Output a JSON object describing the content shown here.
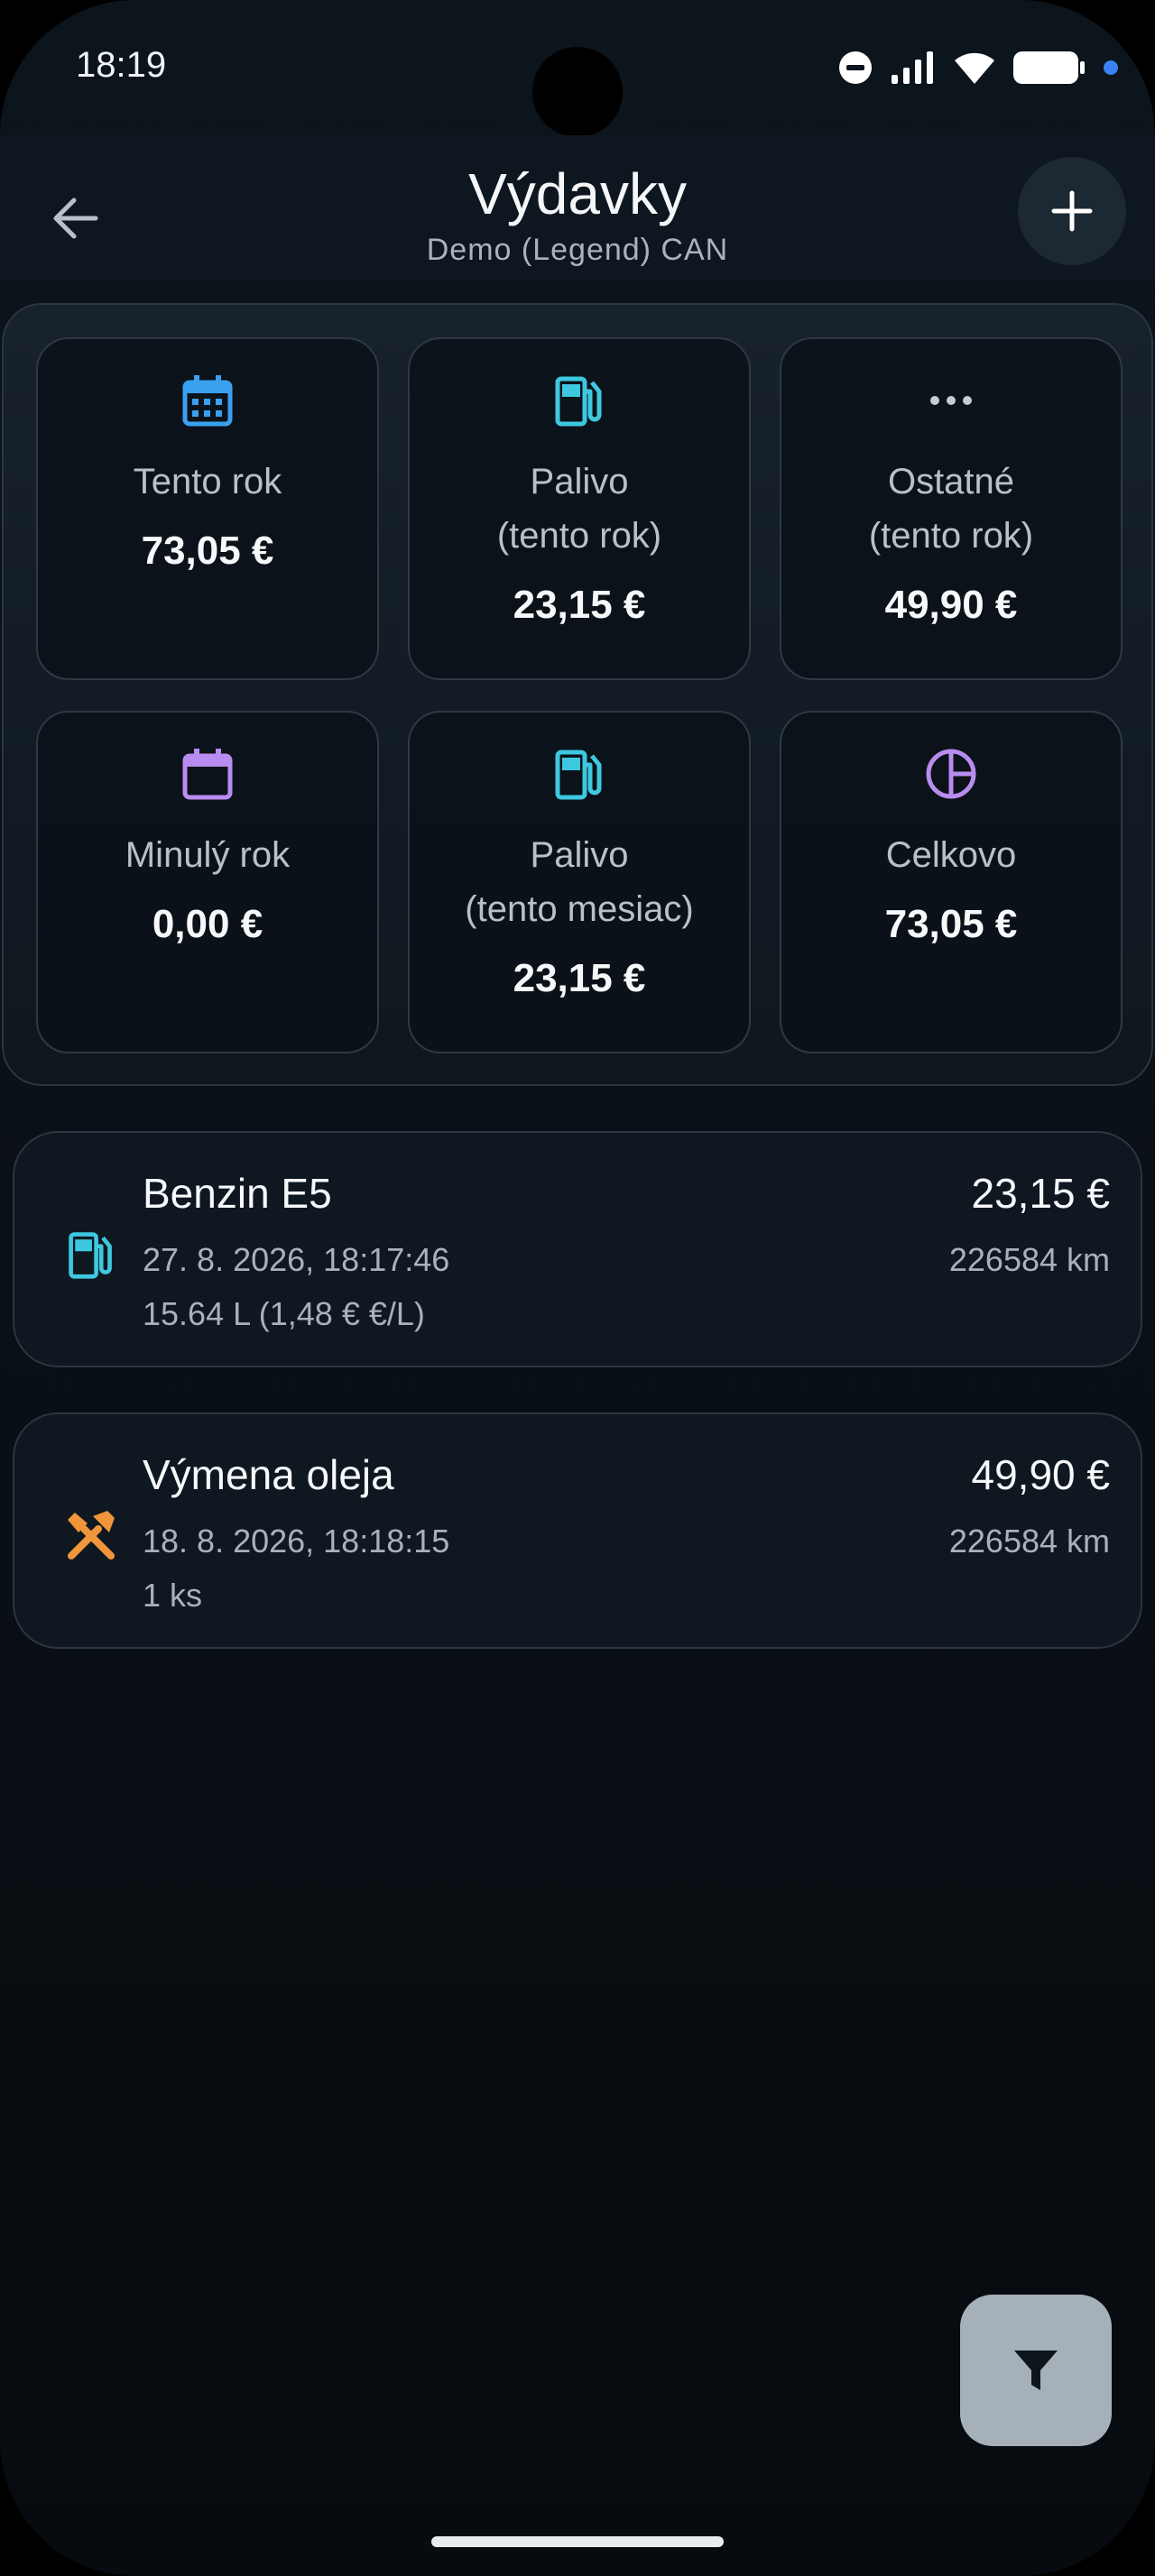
{
  "status_bar": {
    "time": "18:19"
  },
  "header": {
    "title": "Výdavky",
    "subtitle": "Demo (Legend) CAN"
  },
  "summary": {
    "cards": [
      {
        "icon": "calendar-icon",
        "label_line1": "Tento rok",
        "label_line2": "",
        "value": "73,05 €",
        "icon_color": "#3aa0f0"
      },
      {
        "icon": "fuel-pump-icon",
        "label_line1": "Palivo",
        "label_line2": "(tento rok)",
        "value": "23,15 €",
        "icon_color": "#3ec8e0"
      },
      {
        "icon": "more-icon",
        "label_line1": "Ostatné",
        "label_line2": "(tento rok)",
        "value": "49,90 €",
        "icon_color": "#c4ccd4"
      },
      {
        "icon": "calendar-icon",
        "label_line1": "Minulý rok",
        "label_line2": "",
        "value": "0,00 €",
        "icon_color": "#b98cf0"
      },
      {
        "icon": "fuel-pump-icon",
        "label_line1": "Palivo",
        "label_line2": "(tento mesiac)",
        "value": "23,15 €",
        "icon_color": "#3ec8e0"
      },
      {
        "icon": "pie-chart-icon",
        "label_line1": "Celkovo",
        "label_line2": "",
        "value": "73,05 €",
        "icon_color": "#b98cf0"
      }
    ]
  },
  "expenses": [
    {
      "icon": "fuel-pump-icon",
      "icon_color": "#3ec8e0",
      "title": "Benzin E5",
      "date": "27. 8. 2026, 18:17:46",
      "detail": "15.64 L (1,48 € €/L)",
      "amount": "23,15 €",
      "km": "226584 km"
    },
    {
      "icon": "tools-icon",
      "icon_color": "#f0953a",
      "title": "Výmena oleja",
      "date": "18. 8. 2026, 18:18:15",
      "detail": "1 ks",
      "amount": "49,90 €",
      "km": "226584 km"
    }
  ],
  "colors": {
    "background": "#0a1117",
    "card_border": "#2d3944",
    "filter_fab": "#a6b0b8"
  }
}
